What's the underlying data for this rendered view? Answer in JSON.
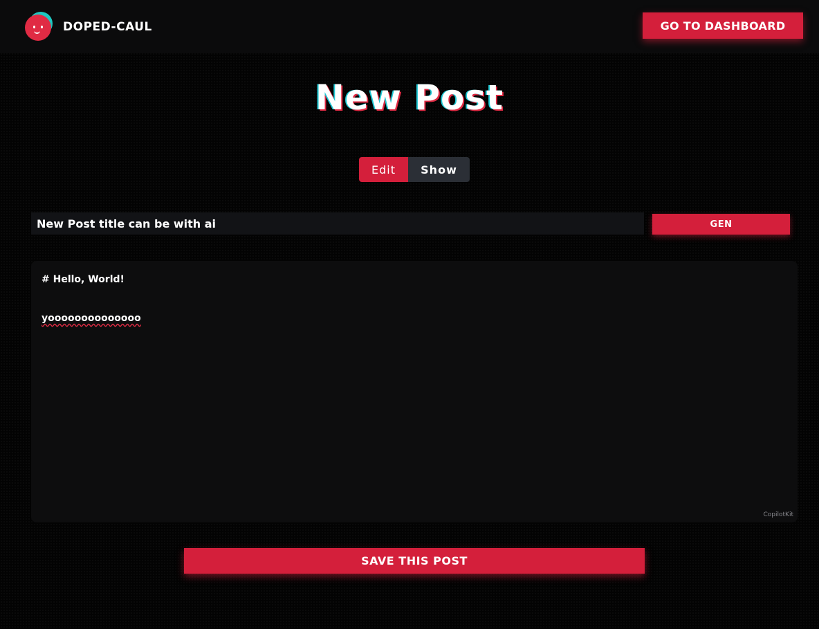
{
  "header": {
    "brand_name": "DOPED-CAUL",
    "dashboard_button": "GO TO DASHBOARD"
  },
  "main": {
    "title": "New Post",
    "tabs": [
      {
        "label": "Edit",
        "active": true
      },
      {
        "label": "Show",
        "active": false
      }
    ],
    "post_title_input": {
      "value": "New Post title can be with ai",
      "placeholder": ""
    },
    "gen_button": "GEN",
    "editor": {
      "lines": [
        "# Hello, World!",
        "yoooooooooooooo"
      ],
      "brand": "CopilotKit"
    },
    "save_button": "SAVE THIS POST"
  },
  "colors": {
    "accent": "#d41f3b",
    "background": "#030303",
    "input_bg": "#121316",
    "editor_bg": "#0d0d0e",
    "tab_inactive": "#2b2f36",
    "logo_teal": "#1fc7c1"
  },
  "icons": {
    "logo": "smiley-face-logo-icon"
  }
}
